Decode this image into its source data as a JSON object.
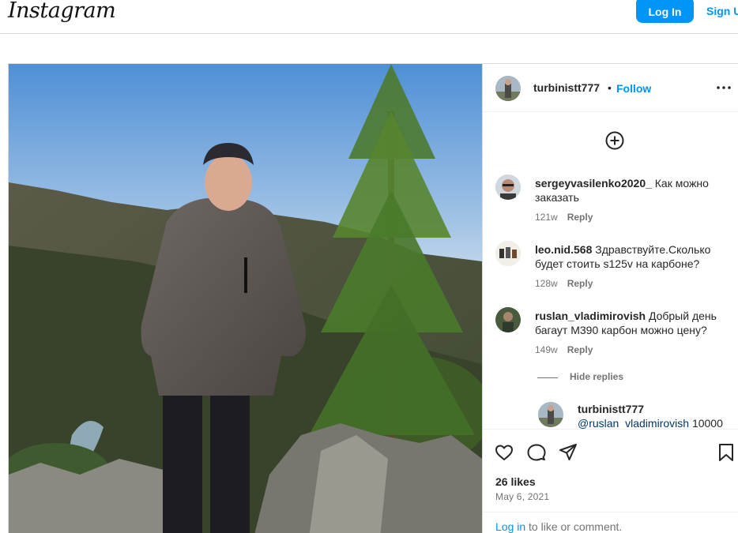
{
  "nav": {
    "logo": "Instagram",
    "login_label": "Log In",
    "signup_label": "Sign Up"
  },
  "post": {
    "author": "turbinistt777",
    "separator": "•",
    "follow_label": "Follow",
    "photo_icon": "person-on-cliff-photo",
    "add_icon": "plus-circle-icon",
    "more_icon": "more-horizontal-icon",
    "comments": [
      {
        "user": "sergeyvasilenko2020_",
        "text": "Как можно заказать",
        "time": "121w",
        "reply_label": "Reply"
      },
      {
        "user": "leo.nid.568",
        "text": "Здравствуйте.Сколько будет стоить s125v на карбоне?",
        "time": "128w",
        "reply_label": "Reply"
      },
      {
        "user": "ruslan_vladimirovish",
        "text": "Добрый день багаут М390 карбон можно цену?",
        "time": "149w",
        "reply_label": "Reply"
      }
    ],
    "hide_replies_label": "Hide replies",
    "reply": {
      "user": "turbinistt777",
      "mention": "@ruslan_vladimirovish",
      "text": "10000"
    },
    "actions": {
      "like_icon": "heart-icon",
      "comment_icon": "comment-icon",
      "share_icon": "send-icon",
      "save_icon": "bookmark-icon"
    },
    "likes": "26 likes",
    "date": "May 6, 2021",
    "login_link": "Log in",
    "login_suffix": " to like or comment."
  },
  "colors": {
    "accent": "#0095f6",
    "muted": "#737373",
    "border": "#dbdbdb"
  }
}
